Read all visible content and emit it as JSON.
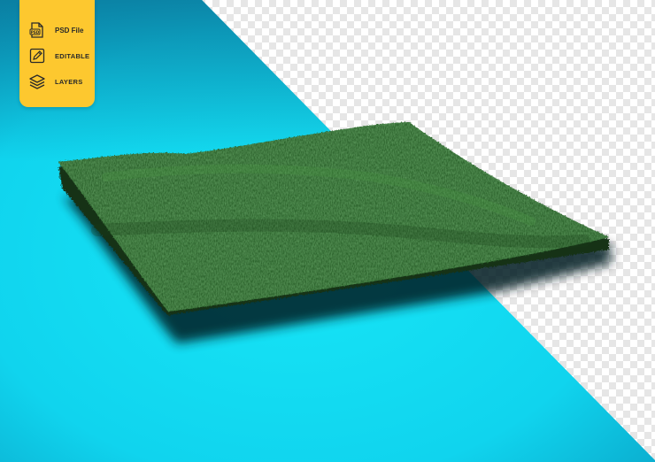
{
  "badge": {
    "items": [
      {
        "icon": "psd-file-icon",
        "label": "PSD File"
      },
      {
        "icon": "pencil-edit-icon",
        "label": "EDITABLE"
      },
      {
        "icon": "layers-icon",
        "label": "LAYERS"
      }
    ]
  },
  "colors": {
    "badge": "#fdc82f",
    "cyan_background": "#13d8f0",
    "cyan_dark_corner": "#0a7ea3",
    "grass_dark": "#1f4a22",
    "grass_light": "#3f8a3a",
    "checker_light": "#ffffff",
    "checker_dark": "#e6e6e6"
  },
  "scene": {
    "subject": "grass-patch",
    "background": "transparent-checkerboard-with-cyan-diagonal"
  }
}
